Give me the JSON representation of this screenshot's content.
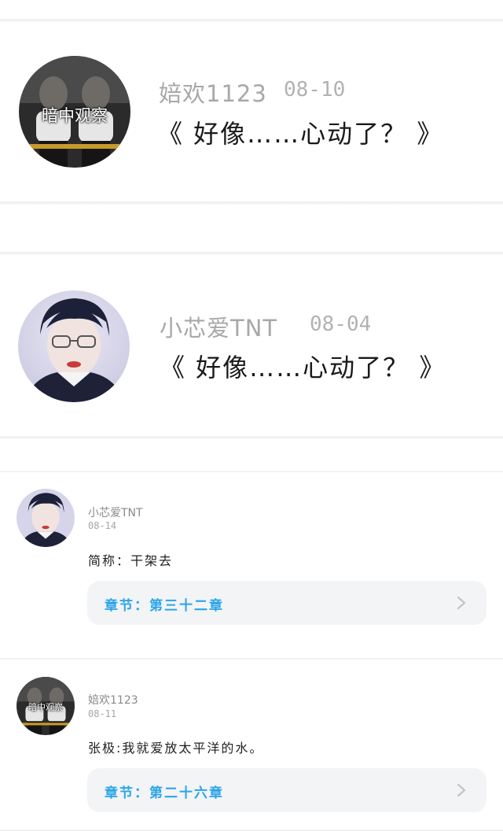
{
  "cards": [
    {
      "avatar_caption": "暗中观察",
      "name": "婄欢1123",
      "date": "08-10",
      "title": "《 好像……心动了？ 》"
    },
    {
      "avatar_caption": "",
      "name": "小芯爱TNT",
      "date": "08-04",
      "title": "《 好像……心动了？ 》"
    }
  ],
  "comments": [
    {
      "avatar_caption": "",
      "name": "小芯爱TNT",
      "date": "08-14",
      "text": "简称：干架去",
      "chapter": "章节：第三十二章"
    },
    {
      "avatar_caption": "暗中观察",
      "name": "婄欢1123",
      "date": "08-11",
      "text": "张极:我就爱放太平洋的水。",
      "chapter": "章节：第二十六章"
    }
  ],
  "icons": {
    "chevron": "chevron-right-icon"
  },
  "colors": {
    "accent": "#2ba5e8",
    "muted_text": "#a8a8a8",
    "button_bg": "#f3f4f6"
  }
}
